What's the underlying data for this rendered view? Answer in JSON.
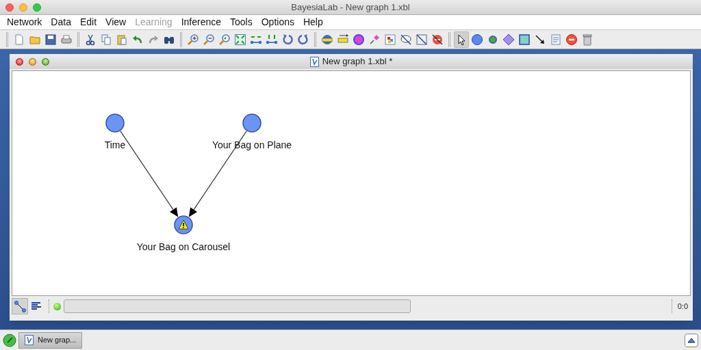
{
  "window": {
    "title": "BayesiaLab - New graph 1.xbl"
  },
  "menu": [
    {
      "label": "Network",
      "disabled": false
    },
    {
      "label": "Data",
      "disabled": false
    },
    {
      "label": "Edit",
      "disabled": false
    },
    {
      "label": "View",
      "disabled": false
    },
    {
      "label": "Learning",
      "disabled": true
    },
    {
      "label": "Inference",
      "disabled": false
    },
    {
      "label": "Tools",
      "disabled": false
    },
    {
      "label": "Options",
      "disabled": false
    },
    {
      "label": "Help",
      "disabled": false
    }
  ],
  "toolbar": {
    "groups": [
      {
        "items": [
          {
            "kind": "new"
          },
          {
            "kind": "open"
          },
          {
            "kind": "save"
          },
          {
            "kind": "print"
          }
        ]
      },
      {
        "items": [
          {
            "kind": "cut"
          },
          {
            "kind": "copy"
          },
          {
            "kind": "paste"
          },
          {
            "kind": "undo"
          },
          {
            "kind": "redo"
          },
          {
            "kind": "find"
          }
        ]
      },
      {
        "items": [
          {
            "kind": "zoomin"
          },
          {
            "kind": "zoomout"
          },
          {
            "kind": "zoomfit"
          },
          {
            "kind": "fit"
          },
          {
            "kind": "spreadh"
          },
          {
            "kind": "spreadv"
          },
          {
            "kind": "rotl"
          },
          {
            "kind": "rotr"
          }
        ]
      },
      {
        "items": [
          {
            "kind": "nodelabel"
          },
          {
            "kind": "linklabel"
          },
          {
            "kind": "target"
          },
          {
            "kind": "pin"
          },
          {
            "kind": "image"
          },
          {
            "kind": "nocomment"
          },
          {
            "kind": "nonote"
          },
          {
            "kind": "nodelete"
          }
        ]
      }
    ],
    "palette": [
      {
        "kind": "pointer",
        "selected": true
      },
      {
        "kind": "node",
        "selected": false
      },
      {
        "kind": "smallnode",
        "selected": false
      },
      {
        "kind": "diamond",
        "selected": false
      },
      {
        "kind": "square",
        "selected": false
      },
      {
        "kind": "arc",
        "selected": false
      },
      {
        "kind": "note",
        "selected": false
      },
      {
        "kind": "stop",
        "selected": false
      },
      {
        "kind": "trash",
        "selected": false
      }
    ]
  },
  "graph_window": {
    "title": "New graph 1.xbl *",
    "nodes": [
      {
        "label": "Time",
        "warning": false
      },
      {
        "label": "Your Bag on Plane",
        "warning": false
      },
      {
        "label": "Your Bag on Carousel",
        "warning": true
      }
    ],
    "view_modes": [
      {
        "kind": "graph",
        "selected": true
      },
      {
        "kind": "text",
        "selected": false
      }
    ],
    "position": "0:0"
  },
  "taskbar": {
    "items": [
      {
        "label": "New grap..."
      }
    ]
  }
}
